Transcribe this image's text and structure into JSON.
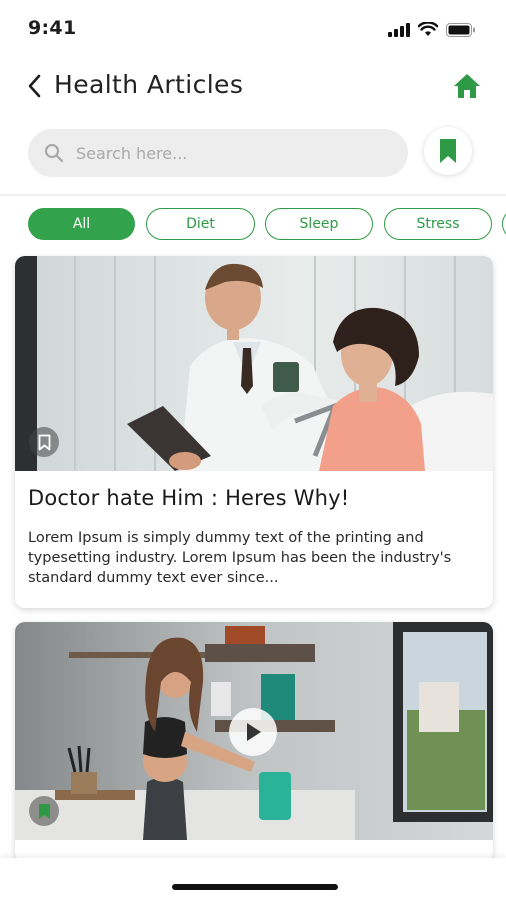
{
  "status_bar": {
    "time": "9:41"
  },
  "header": {
    "title": "Health Articles",
    "back_icon": "chevron-left-icon",
    "home_icon": "home-icon"
  },
  "search": {
    "placeholder": "Search here...",
    "value": ""
  },
  "colors": {
    "accent": "#33a24c",
    "chip_border": "#2e9a45",
    "search_bg": "#ededed"
  },
  "categories": [
    {
      "label": "All",
      "active": true
    },
    {
      "label": "Diet",
      "active": false
    },
    {
      "label": "Sleep",
      "active": false
    },
    {
      "label": "Stress",
      "active": false
    }
  ],
  "articles": [
    {
      "title": "Doctor hate Him : Heres Why!",
      "description": "Lorem Ipsum is simply dummy text of the printing and typesetting industry. Lorem Ipsum has been the industry's standard dummy text ever since...",
      "image": "doctor-with-patient-photo",
      "bookmarked": false
    },
    {
      "title": "",
      "description": "",
      "image": "woman-in-kitchen-video-thumbnail",
      "has_video": true,
      "bookmarked": true
    }
  ]
}
